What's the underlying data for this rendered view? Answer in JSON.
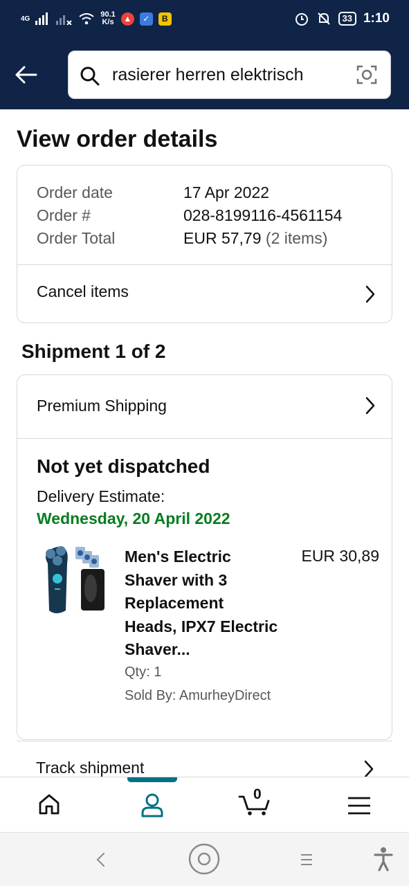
{
  "status_bar": {
    "network": "4G",
    "speed_value": "90.1",
    "speed_unit": "K/s",
    "badge_b": "B",
    "battery": "33",
    "time": "1:10"
  },
  "search": {
    "query": "rasierer herren elektrisch"
  },
  "page": {
    "title": "View order details"
  },
  "order": {
    "date_label": "Order date",
    "date_value": "17 Apr 2022",
    "number_label": "Order #",
    "number_value": "028-8199116-4561154",
    "total_label": "Order Total",
    "total_value": "EUR 57,79",
    "total_items": "(2 items)",
    "cancel_label": "Cancel items"
  },
  "shipment": {
    "title": "Shipment 1 of 2",
    "shipping_type": "Premium Shipping",
    "status": "Not yet dispatched",
    "estimate_label": "Delivery Estimate:",
    "estimate_date": "Wednesday, 20 April 2022",
    "product": {
      "title_lines": [
        "Men's Electric",
        "Shaver with 3",
        "Replacement",
        "Heads, IPX7 Electric",
        "Shaver..."
      ],
      "price": "EUR 30,89",
      "qty": "Qty: 1",
      "seller": "Sold By: AmurheyDirect"
    },
    "track_label": "Track shipment"
  },
  "bottom_nav": {
    "cart_count": "0",
    "items": [
      "home-icon",
      "account-icon",
      "cart-icon",
      "menu-icon"
    ],
    "active": "account-icon"
  },
  "colors": {
    "header_bg": "#0f2447",
    "estimate_green": "#067d20",
    "nav_active": "#007185"
  }
}
